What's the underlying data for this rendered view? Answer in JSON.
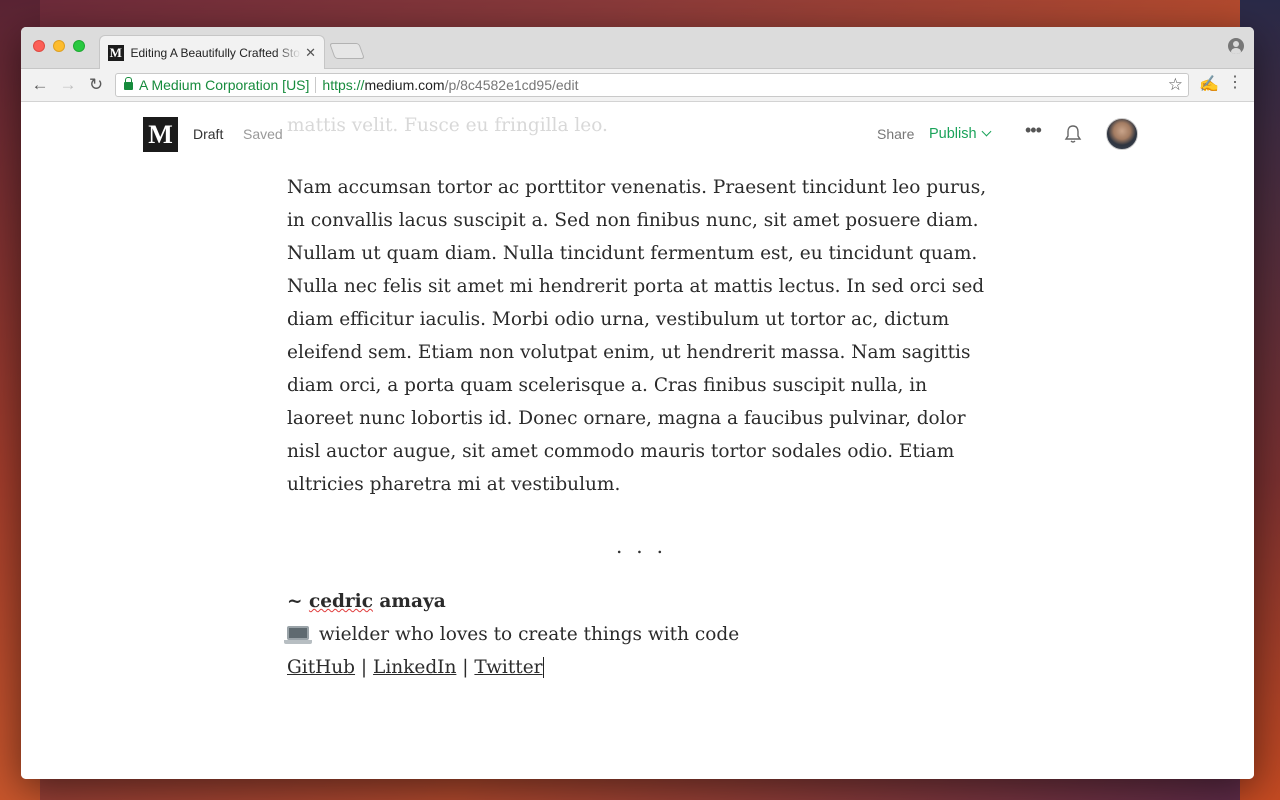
{
  "browser": {
    "tab_title": "Editing A Beautifully Crafted Story – Medium",
    "tab_favicon": "M",
    "tab_close": "✕",
    "security_org": "A Medium Corporation [US]",
    "url_scheme": "https://",
    "url_host": "medium.com",
    "url_path": "/p/8c4582e1cd95/edit",
    "nav_back": "←",
    "nav_forward": "→",
    "nav_reload": "↻",
    "star": "☆",
    "extension": "✍",
    "menu": "⋮"
  },
  "header": {
    "logo": "M",
    "draft_label": "Draft",
    "saved_label": "Saved",
    "share_label": "Share",
    "publish_label": "Publish",
    "more_label": "•••"
  },
  "article": {
    "faded_text": "non, sollicitudin massa. Duis nec enim non nisl mattis mollis pharetra mattis velit. Fusce eu fringilla leo.",
    "paragraph": "Nam accumsan tortor ac porttitor venenatis. Praesent tincidunt leo purus, in convallis lacus suscipit a. Sed non finibus nunc, sit amet posuere diam. Nullam ut quam diam. Nulla tincidunt fermentum est, eu tincidunt quam. Nulla nec felis sit amet mi hendrerit porta at mattis lectus. In sed orci sed diam efficitur iaculis. Morbi odio urna, vestibulum ut tortor ac, dictum eleifend sem. Etiam non volutpat enim, ut hendrerit massa. Nam sagittis diam orci, a porta quam scelerisque a. Cras finibus suscipit nulla, in laoreet nunc lobortis id. Donec ornare, magna a faucibus pulvinar, dolor nisl auctor augue, sit amet commodo mauris tortor sodales odio. Etiam ultricies pharetra mi at vestibulum.",
    "separator": "...",
    "signature_prefix": "~ ",
    "signature_name": "cedric",
    "signature_surname": " amaya",
    "bio": "wielder who loves to create things with code",
    "links": [
      "GitHub",
      "LinkedIn",
      "Twitter"
    ],
    "link_separator": "|"
  },
  "colors": {
    "brand": "#1b1b1b",
    "publish": "#1aa35a",
    "secure": "#168b3c"
  }
}
